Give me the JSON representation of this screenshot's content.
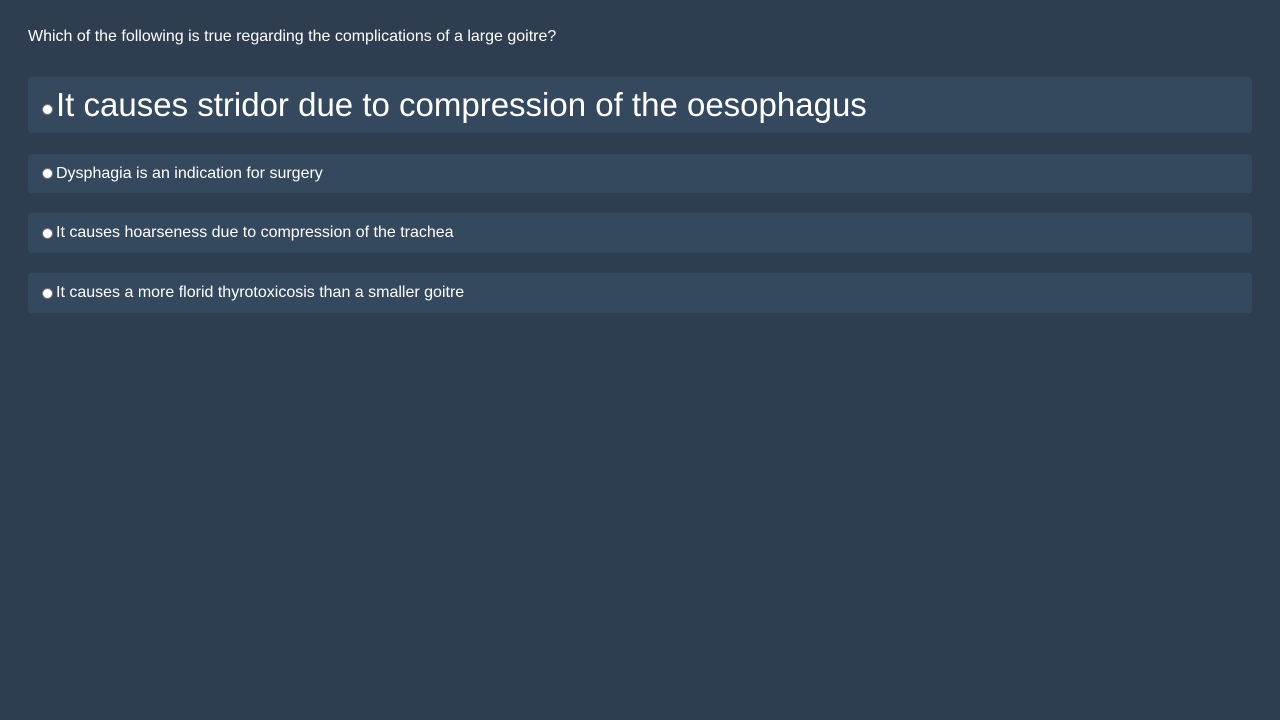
{
  "question": {
    "text": "Which of the following is true regarding the complications of a large goitre?"
  },
  "options": [
    {
      "label": "It causes stridor due to compression of the oesophagus",
      "selected": false
    },
    {
      "label": "Dysphagia is an indication for surgery",
      "selected": false
    },
    {
      "label": "It causes hoarseness due to compression of the trachea",
      "selected": false
    },
    {
      "label": "It causes a more florid thyrotoxicosis than a smaller goitre",
      "selected": false
    }
  ],
  "colors": {
    "background": "#2e3d4f",
    "option_background": "#34495e",
    "text": "#ffffff"
  }
}
